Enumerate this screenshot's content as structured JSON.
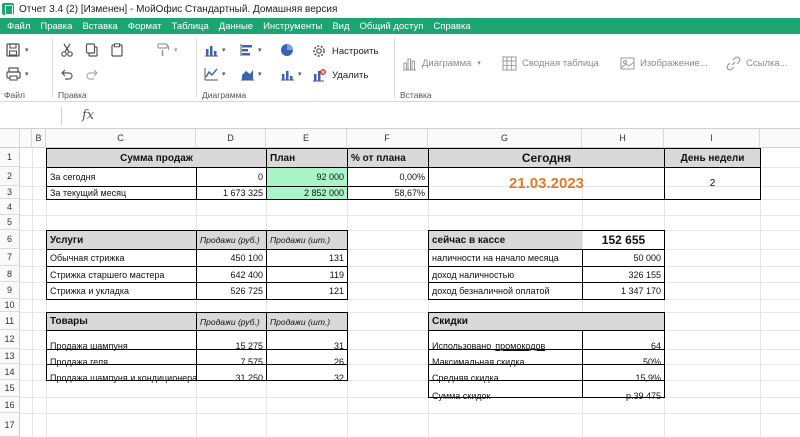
{
  "window": {
    "title": "Отчет 3.4 (2) [Изменен] - МойОфис Стандартный. Домашняя версия"
  },
  "menu": [
    "Файл",
    "Правка",
    "Вставка",
    "Формат",
    "Таблица",
    "Данные",
    "Инструменты",
    "Вид",
    "Общий доступ",
    "Справка"
  ],
  "ribbon": {
    "groups": {
      "file": "Файл",
      "edit": "Правка",
      "chart": "Диаграмма",
      "insert": "Вставка"
    },
    "configure": "Настроить",
    "delete": "Удалить",
    "insert_chart": "Диаграмма",
    "pivot": "Сводная таблица",
    "image": "Изображение...",
    "link": "Ссылка..."
  },
  "formula_bar": {
    "fx": "fx"
  },
  "columns": [
    "B",
    "C",
    "D",
    "E",
    "F",
    "G",
    "H",
    "I"
  ],
  "rows": [
    "1",
    "2",
    "3",
    "4",
    "5",
    "6",
    "7",
    "8",
    "9",
    "10",
    "11",
    "12",
    "13",
    "14",
    "15",
    "16",
    "17"
  ],
  "sales": {
    "header": "Сумма продаж",
    "plan_header": "План",
    "pct_header": "% от плана",
    "today_label": "За сегодня",
    "today_value": "0",
    "today_plan": "92 000",
    "today_pct": "0,00%",
    "month_label": "За текущий месяц",
    "month_value": "1 673 325",
    "month_plan": "2 852 000",
    "month_pct": "58,67%"
  },
  "today": {
    "header": "Сегодня",
    "date": "21.03.2023",
    "accent": "#e07a2c"
  },
  "weekday": {
    "header": "День недели",
    "value": "2"
  },
  "services": {
    "header": "Услуги",
    "col_rub": "Продажи (руб.)",
    "col_qty": "Продажи (шт.)",
    "rows": [
      {
        "name": "Обычная стрижка",
        "rub": "450 100",
        "qty": "131"
      },
      {
        "name": "Стрижка старшего мастера",
        "rub": "642 400",
        "qty": "119"
      },
      {
        "name": "Стрижка и укладка",
        "rub": "526 725",
        "qty": "121"
      }
    ]
  },
  "goods": {
    "header": "Товары",
    "col_rub": "Продажи (руб.)",
    "col_qty": "Продажи (шт.)",
    "rows": [
      {
        "name": "Продажа шампуня",
        "rub": "15 275",
        "qty": "31"
      },
      {
        "name": "Продажа геля",
        "rub": "7 575",
        "qty": "26"
      },
      {
        "name": "Продажа шампуня и кондиционера",
        "rub": "31 250",
        "qty": "32"
      }
    ]
  },
  "cash": {
    "header": "сейчас в кассе",
    "total": "152 655",
    "rows": [
      {
        "label": "наличности на начало месяца",
        "value": "50 000"
      },
      {
        "label": "доход наличностью",
        "value": "326 155"
      },
      {
        "label": "доход безналичной оплатой",
        "value": "1 347 170"
      }
    ]
  },
  "discounts": {
    "header": "Скидки",
    "rows": [
      {
        "label": "Использовано",
        "label2": "промокодов",
        "value": "64"
      },
      {
        "label": "Максимальная скидка",
        "value": "50%"
      },
      {
        "label": "Средняя скидка",
        "value": "15,9%"
      },
      {
        "label": "Сумма скидок",
        "value": "р.39 475"
      }
    ]
  }
}
